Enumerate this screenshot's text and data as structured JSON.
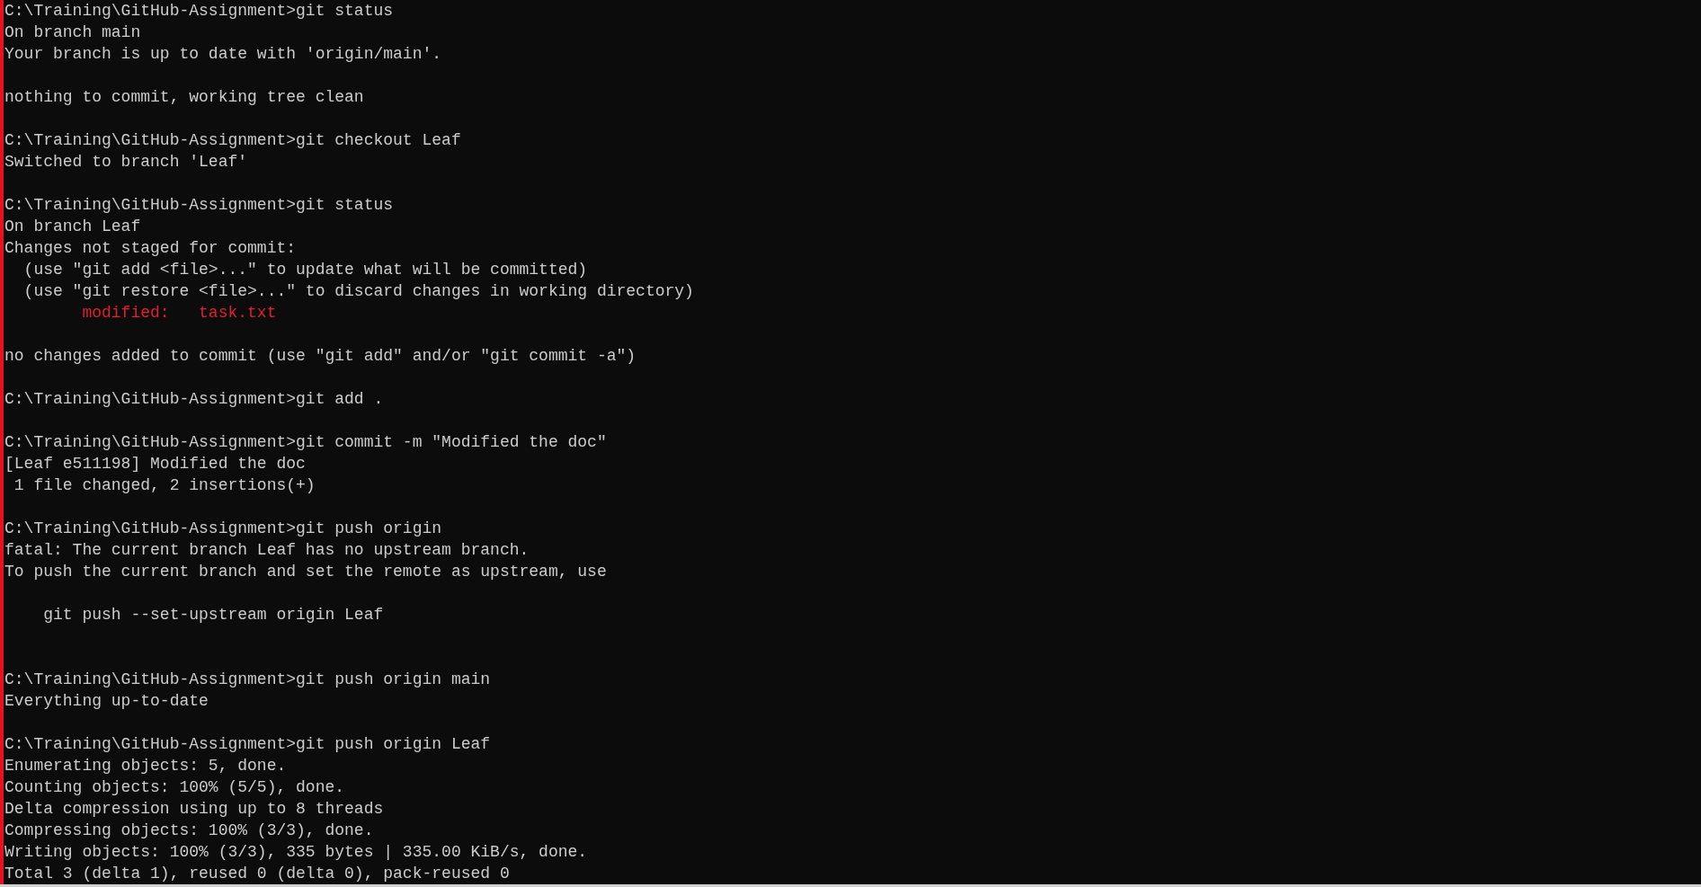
{
  "terminal": {
    "lines": [
      {
        "kind": "output",
        "text": "C:\\Training\\GitHub-Assignment>git status"
      },
      {
        "kind": "output",
        "text": "On branch main"
      },
      {
        "kind": "output",
        "text": "Your branch is up to date with 'origin/main'."
      },
      {
        "kind": "blank"
      },
      {
        "kind": "output",
        "text": "nothing to commit, working tree clean"
      },
      {
        "kind": "blank"
      },
      {
        "kind": "output",
        "text": "C:\\Training\\GitHub-Assignment>git checkout Leaf"
      },
      {
        "kind": "output",
        "text": "Switched to branch 'Leaf'"
      },
      {
        "kind": "blank"
      },
      {
        "kind": "output",
        "text": "C:\\Training\\GitHub-Assignment>git status"
      },
      {
        "kind": "output",
        "text": "On branch Leaf"
      },
      {
        "kind": "output",
        "text": "Changes not staged for commit:"
      },
      {
        "kind": "output",
        "text": "  (use \"git add <file>...\" to update what will be committed)"
      },
      {
        "kind": "output",
        "text": "  (use \"git restore <file>...\" to discard changes in working directory)"
      },
      {
        "kind": "error",
        "text": "        modified:   task.txt"
      },
      {
        "kind": "blank"
      },
      {
        "kind": "output",
        "text": "no changes added to commit (use \"git add\" and/or \"git commit -a\")"
      },
      {
        "kind": "blank"
      },
      {
        "kind": "output",
        "text": "C:\\Training\\GitHub-Assignment>git add ."
      },
      {
        "kind": "blank"
      },
      {
        "kind": "output",
        "text": "C:\\Training\\GitHub-Assignment>git commit -m \"Modified the doc\""
      },
      {
        "kind": "output",
        "text": "[Leaf e511198] Modified the doc"
      },
      {
        "kind": "output",
        "text": " 1 file changed, 2 insertions(+)"
      },
      {
        "kind": "blank"
      },
      {
        "kind": "output",
        "text": "C:\\Training\\GitHub-Assignment>git push origin"
      },
      {
        "kind": "output",
        "text": "fatal: The current branch Leaf has no upstream branch."
      },
      {
        "kind": "output",
        "text": "To push the current branch and set the remote as upstream, use"
      },
      {
        "kind": "blank"
      },
      {
        "kind": "output",
        "text": "    git push --set-upstream origin Leaf"
      },
      {
        "kind": "blank"
      },
      {
        "kind": "blank"
      },
      {
        "kind": "output",
        "text": "C:\\Training\\GitHub-Assignment>git push origin main"
      },
      {
        "kind": "output",
        "text": "Everything up-to-date"
      },
      {
        "kind": "blank"
      },
      {
        "kind": "output",
        "text": "C:\\Training\\GitHub-Assignment>git push origin Leaf"
      },
      {
        "kind": "output",
        "text": "Enumerating objects: 5, done."
      },
      {
        "kind": "output",
        "text": "Counting objects: 100% (5/5), done."
      },
      {
        "kind": "output",
        "text": "Delta compression using up to 8 threads"
      },
      {
        "kind": "output",
        "text": "Compressing objects: 100% (3/3), done."
      },
      {
        "kind": "output",
        "text": "Writing objects: 100% (3/3), 335 bytes | 335.00 KiB/s, done."
      },
      {
        "kind": "output",
        "text": "Total 3 (delta 1), reused 0 (delta 0), pack-reused 0"
      }
    ]
  }
}
